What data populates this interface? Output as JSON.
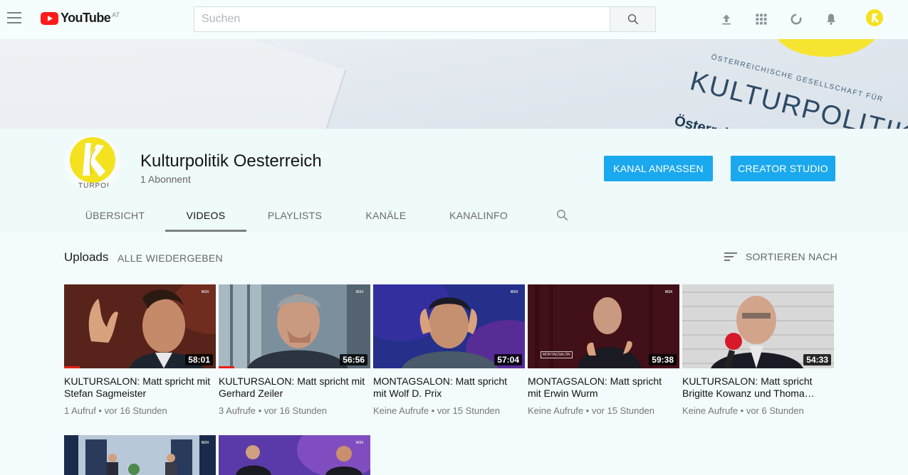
{
  "topbar": {
    "logo_text": "YouTube",
    "country": "AT",
    "search_placeholder": "Suchen",
    "icons": [
      "upload-icon",
      "apps-icon",
      "messages-icon",
      "notifications-icon",
      "account-avatar"
    ]
  },
  "banner": {
    "line1": "ÖSTERREICHISCHE GESELLSCHAFT FÜR",
    "line2": "KULTURPOLITIK",
    "line3": "Österreichische G"
  },
  "channel": {
    "name": "Kulturpolitik Oesterreich",
    "subscribers": "1 Abonnent",
    "avatar_text": "TURPOL",
    "customize_label": "KANAL ANPASSEN",
    "studio_label": "CREATOR STUDIO"
  },
  "tabs": [
    {
      "label": "ÜBERSICHT",
      "active": false
    },
    {
      "label": "VIDEOS",
      "active": true
    },
    {
      "label": "PLAYLISTS",
      "active": false
    },
    {
      "label": "KANÄLE",
      "active": false
    },
    {
      "label": "KANALINFO",
      "active": false
    }
  ],
  "section": {
    "title": "Uploads",
    "play_all": "ALLE WIEDERGEBEN",
    "sort_label": "SORTIEREN NACH"
  },
  "videos": [
    {
      "title": "KULTURSALON: Matt spricht mit Stefan Sagmeister",
      "duration": "58:01",
      "meta": "1 Aufruf • vor 16 Stunden",
      "watched": true
    },
    {
      "title": "KULTURSALON: Matt spricht mit Gerhard Zeiler",
      "duration": "56:56",
      "meta": "3 Aufrufe • vor 16 Stunden",
      "watched": true
    },
    {
      "title": "MONTAGSALON: Matt spricht mit Wolf D. Prix",
      "duration": "57:04",
      "meta": "Keine Aufrufe • vor 15 Stunden",
      "watched": false
    },
    {
      "title": "MONTAGSALON: Matt spricht mit Erwin Wurm",
      "duration": "59:38",
      "meta": "Keine Aufrufe • vor 15 Stunden",
      "watched": false
    },
    {
      "title": "KULTURSALON: Matt spricht Brigitte Kowanz und Thoma…",
      "duration": "54:33",
      "meta": "Keine Aufrufe • vor 6 Stunden",
      "watched": false
    }
  ],
  "thumb_overlays": {
    "channel_tag": "W24",
    "montagsalon_tag": "MONTAGSALON"
  },
  "colors": {
    "accent": "#1aa8ee",
    "youtube_red": "#ff1a1a",
    "brand_yellow": "#f6e431"
  }
}
